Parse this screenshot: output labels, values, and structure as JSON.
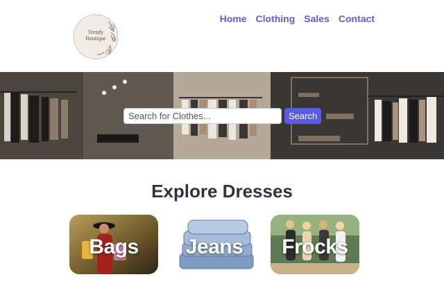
{
  "brand": {
    "logo_line1": "Trendy",
    "logo_line2": "Boutique"
  },
  "nav": {
    "items": [
      "Home",
      "Clothing",
      "Sales",
      "Contact"
    ]
  },
  "search": {
    "placeholder": "Search for Clothes...",
    "button_label": "Search"
  },
  "explore": {
    "title": "Explore Dresses",
    "cards": [
      {
        "label": "Bags"
      },
      {
        "label": "Jeans"
      },
      {
        "label": "Frocks"
      }
    ]
  },
  "colors": {
    "accent": "#5a5ce8",
    "heading": "#2d3340"
  }
}
